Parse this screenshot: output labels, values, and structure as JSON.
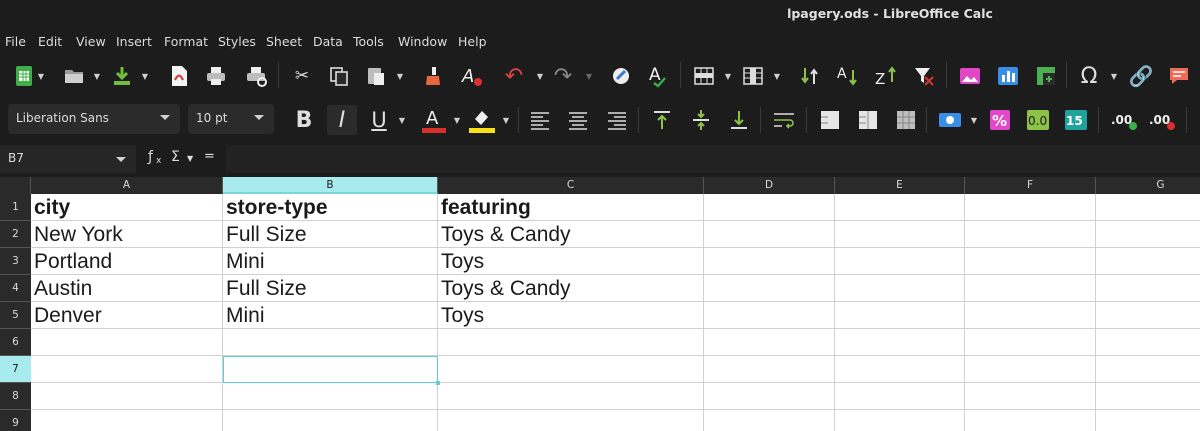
{
  "window": {
    "title": "lpagery.ods - LibreOffice Calc"
  },
  "menu": [
    "File",
    "Edit",
    "View",
    "Insert",
    "Format",
    "Styles",
    "Sheet",
    "Data",
    "Tools",
    "Window",
    "Help"
  ],
  "formatting": {
    "font_name": "Liberation Sans",
    "font_size": "10 pt"
  },
  "formula_bar": {
    "name_box": "B7",
    "content": ""
  },
  "columns": [
    "A",
    "B",
    "C",
    "D",
    "E",
    "F",
    "G"
  ],
  "rows": [
    "1",
    "2",
    "3",
    "4",
    "5",
    "6",
    "7",
    "8",
    "9"
  ],
  "selected": {
    "column": "B",
    "row": "7"
  },
  "cells": [
    [
      "city",
      "store-type",
      "featuring"
    ],
    [
      "New York",
      "Full Size",
      "Toys & Candy"
    ],
    [
      "Portland",
      "Mini",
      "Toys"
    ],
    [
      "Austin",
      "Full Size",
      "Toys & Candy"
    ],
    [
      "Denver",
      "Mini",
      "Toys"
    ]
  ],
  "colors": {
    "accent": "#a8ebee",
    "cursor": "#5fd0d5",
    "background": "#1c1c1c"
  },
  "icons_row1": [
    "new-document",
    "open",
    "save",
    "export-pdf",
    "print",
    "print-preview",
    "cut",
    "copy",
    "paste",
    "clone-formatting",
    "clear-formatting",
    "undo",
    "redo",
    "find-replace",
    "spelling",
    "row",
    "column",
    "sort-ascending",
    "sort-descending",
    "autofilter",
    "insert-image",
    "insert-chart",
    "pivot-table",
    "special-character",
    "hyperlink",
    "comment"
  ],
  "icons_row2": [
    "bold",
    "italic",
    "underline",
    "font-color",
    "highlight",
    "align-left",
    "align-center",
    "align-right",
    "align-top",
    "center-vertically",
    "align-bottom",
    "wrap-text",
    "merge-cells",
    "unmerge",
    "split",
    "currency",
    "percent",
    "number",
    "date",
    "add-decimal",
    "delete-decimal"
  ]
}
